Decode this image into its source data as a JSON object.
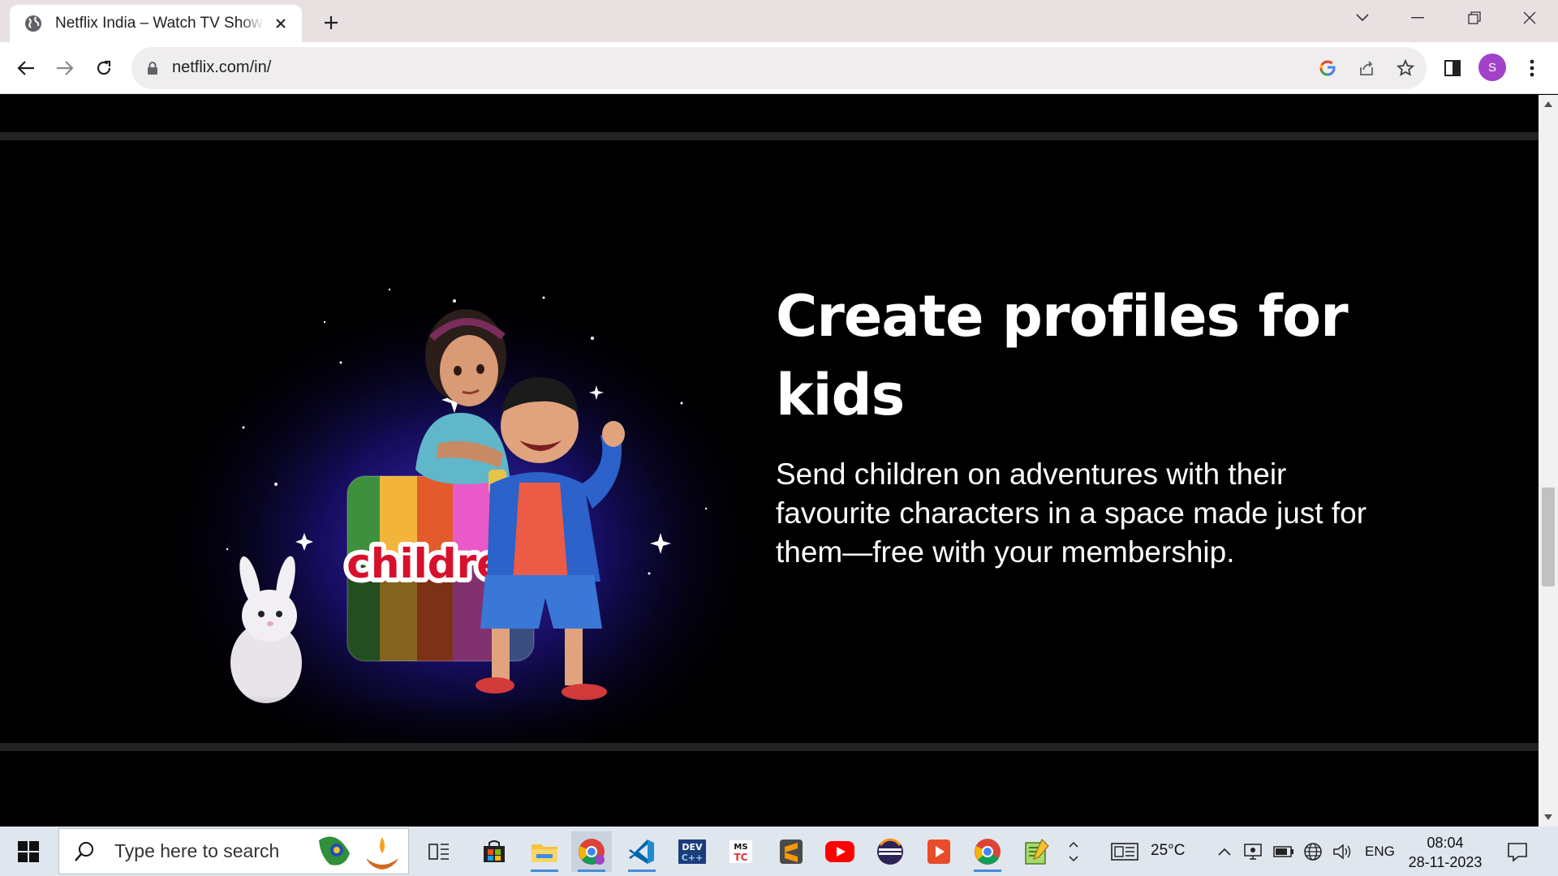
{
  "browser": {
    "tab_title": "Netflix India – Watch TV Shows Online",
    "url": "netflix.com/in/",
    "profile_initial": "S"
  },
  "page": {
    "heading": "Create profiles for kids",
    "body": "Send children on adventures with their favourite characters in a space made just for them—free with your membership.",
    "art_label": "children",
    "colors": {
      "background": "#000000",
      "divider": "#232323",
      "text": "#ffffff"
    }
  },
  "taskbar": {
    "search_placeholder": "Type here to search",
    "weather": "25°C",
    "language": "ENG",
    "time": "08:04",
    "date": "28-11-2023",
    "apps": [
      "task-view",
      "microsoft-store",
      "file-explorer",
      "chrome",
      "vscode",
      "dev-cpp",
      "ms-tc",
      "sublime-text",
      "youtube",
      "eclipse",
      "powerpoint-app",
      "chrome-profile",
      "notepad-plus"
    ]
  }
}
